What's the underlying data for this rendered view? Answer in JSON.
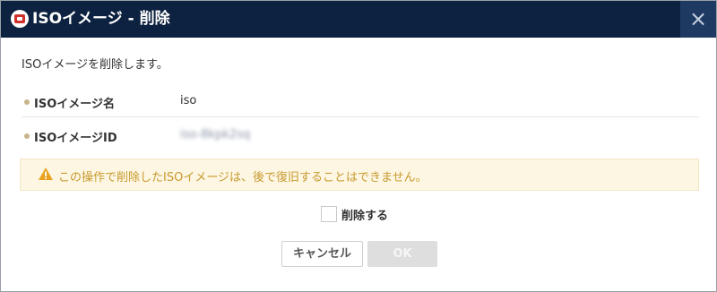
{
  "dialog": {
    "title": "ISOイメージ - 削除",
    "close_glyph": "×",
    "description": "ISOイメージを削除します。"
  },
  "fields": [
    {
      "label": "ISOイメージ名",
      "value": "iso"
    },
    {
      "label": "ISOイメージID",
      "value": "iso-8kpk2sq"
    }
  ],
  "warning": {
    "icon": "warning-triangle-icon",
    "text": "この操作で削除したISOイメージは、後で復旧することはできません。"
  },
  "confirm": {
    "label": "削除する",
    "checked": false
  },
  "buttons": {
    "cancel_label": "キャンセル",
    "ok_label": "OK",
    "ok_enabled": false
  },
  "colors": {
    "titlebar": "#0d2240",
    "close_button_bg": "#1e3a63",
    "warning_bg": "#fdf6e3",
    "warning_text": "#c79a2d",
    "bullet": "#c8b48a",
    "ok_disabled_bg": "#dedede"
  }
}
